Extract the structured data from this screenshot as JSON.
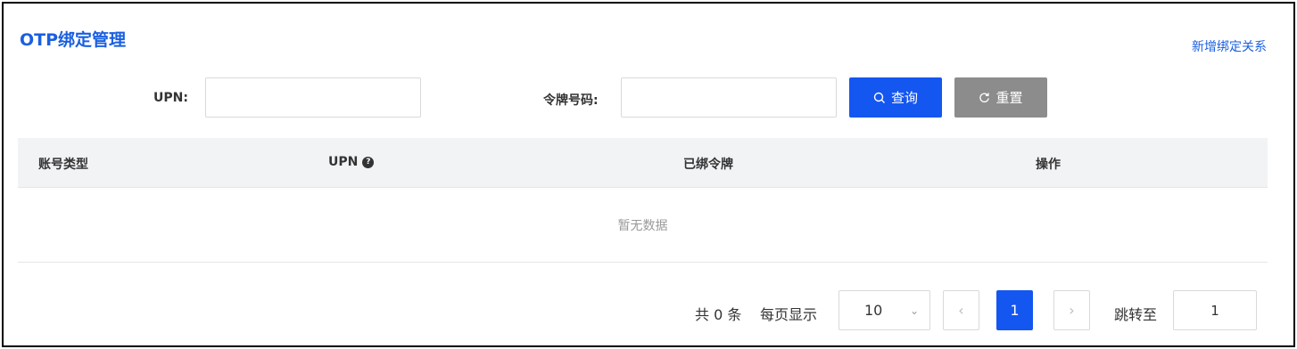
{
  "header": {
    "title": "OTP绑定管理",
    "add_link": "新增绑定关系"
  },
  "search": {
    "upn_label": "UPN:",
    "upn_value": "",
    "token_label": "令牌号码:",
    "token_value": "",
    "query_label": "查询",
    "reset_label": "重置"
  },
  "table": {
    "columns": [
      "账号类型",
      "UPN",
      "已绑令牌",
      "操作"
    ],
    "empty_text": "暂无数据"
  },
  "pagination": {
    "total_text": "共 0 条",
    "per_page_label": "每页显示",
    "per_page_value": "10",
    "current_page": "1",
    "jump_label": "跳转至",
    "jump_value": "1"
  }
}
